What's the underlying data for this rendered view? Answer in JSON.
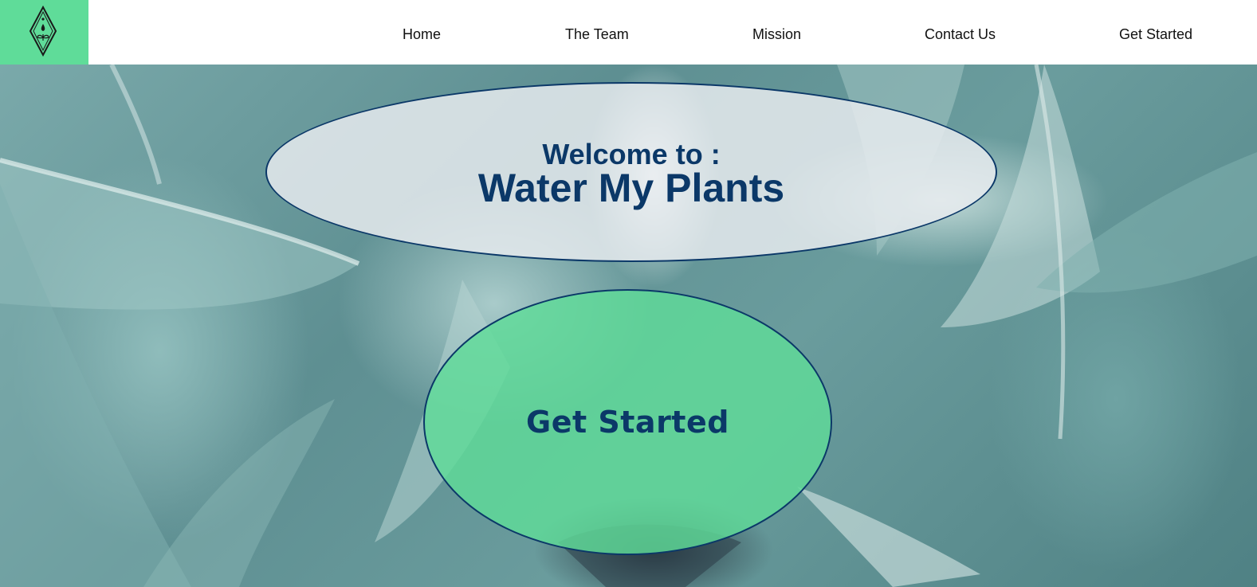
{
  "logo": {
    "icon": "diamond-plant-logo-icon",
    "color": "#5fdc99"
  },
  "nav": {
    "items": [
      {
        "label": "Home"
      },
      {
        "label": "The Team"
      },
      {
        "label": "Mission"
      },
      {
        "label": "Contact Us"
      },
      {
        "label": "Get Started"
      }
    ]
  },
  "hero": {
    "background": "succulent-leaves-image",
    "welcome_text": "Welcome to :",
    "title": "Water My Plants",
    "cta_label": "Get Started"
  },
  "colors": {
    "accent": "#5fdc99",
    "text_dark_blue": "#0b3868",
    "header_bg": "#ffffff"
  }
}
